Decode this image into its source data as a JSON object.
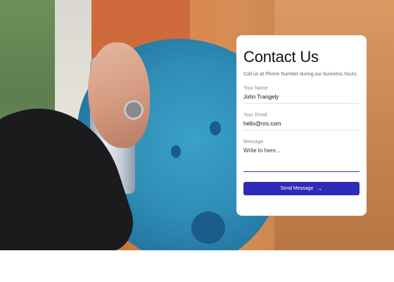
{
  "contact": {
    "title": "Contact Us",
    "subtitle": "Call us at Phone Number during our business hours.",
    "name_label": "Your Name",
    "name_value": "John Trangely",
    "email_label": "Your Email",
    "email_value": "hello@nrs.com",
    "message_label": "Message",
    "message_placeholder": "Write to here...",
    "send_label": "Send Message",
    "send_icon": "arrow-right-icon",
    "accent_color": "#2e2bb8"
  }
}
